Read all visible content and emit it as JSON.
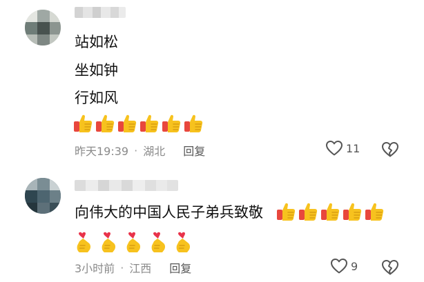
{
  "colors": {
    "text": "#111111",
    "meta": "#8a8a8a",
    "icon": "#555555",
    "thumb_yellow": "#f7c21e",
    "thumb_sleeve": "#e8473d",
    "heart_red": "#e8334a"
  },
  "comments": [
    {
      "lines": [
        "站如松",
        "坐如钟",
        "行如风"
      ],
      "emoji": {
        "name": "thumbs-up-emoji",
        "count": 6
      },
      "time": "昨天19:39",
      "separator": "·",
      "location": "湖北",
      "reply_label": "回复",
      "likes": "11"
    },
    {
      "lines": [
        "向伟大的中国人民子弟兵致敬"
      ],
      "emoji": {
        "name": "thumbs-up-emoji",
        "count": 5
      },
      "emoji_row2": {
        "name": "finger-heart-emoji",
        "count": 5
      },
      "time": "3小时前",
      "separator": "·",
      "location": "江西",
      "reply_label": "回复",
      "likes": "9"
    }
  ]
}
